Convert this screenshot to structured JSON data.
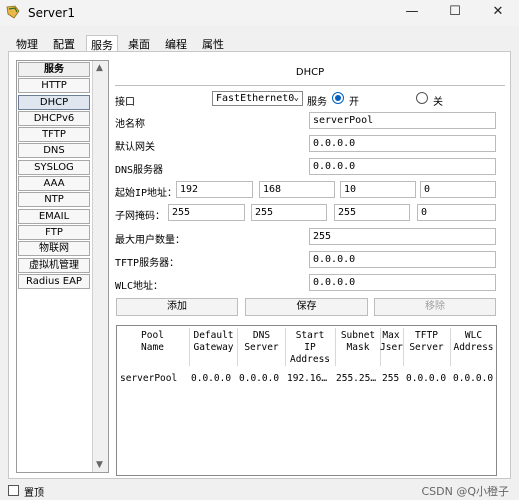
{
  "window": {
    "title": "Server1",
    "minimize": "—",
    "maximize": "☐",
    "close": "✕"
  },
  "tabs": [
    {
      "label": "物理"
    },
    {
      "label": "配置"
    },
    {
      "label": "服务"
    },
    {
      "label": "桌面"
    },
    {
      "label": "编程"
    },
    {
      "label": "属性"
    }
  ],
  "sidebar": {
    "items": [
      {
        "label": "服务"
      },
      {
        "label": "HTTP"
      },
      {
        "label": "DHCP"
      },
      {
        "label": "DHCPv6"
      },
      {
        "label": "TFTP"
      },
      {
        "label": "DNS"
      },
      {
        "label": "SYSLOG"
      },
      {
        "label": "AAA"
      },
      {
        "label": "NTP"
      },
      {
        "label": "EMAIL"
      },
      {
        "label": "FTP"
      },
      {
        "label": "物联网"
      },
      {
        "label": "虚拟机管理"
      },
      {
        "label": "Radius EAP"
      }
    ]
  },
  "dhcp": {
    "title": "DHCP",
    "interface_label": "接口",
    "interface_value": "FastEthernet0",
    "service_label": "服务",
    "on_label": "开",
    "off_label": "关",
    "pool_name_label": "池名称",
    "pool_name_value": "serverPool",
    "gateway_label": "默认网关",
    "gateway_value": "0.0.0.0",
    "dns_label": "DNS服务器",
    "dns_value": "0.0.0.0",
    "start_ip_label": "起始IP地址：",
    "start_ip": [
      "192",
      "168",
      "10",
      "0"
    ],
    "mask_label": "子网掩码：",
    "mask": [
      "255",
      "255",
      "255",
      "0"
    ],
    "max_users_label": "最大用户数量：",
    "max_users_value": "255",
    "tftp_label": "TFTP服务器：",
    "tftp_value": "0.0.0.0",
    "wlc_label": "WLC地址：",
    "wlc_value": "0.0.0.0",
    "add_button": "添加",
    "save_button": "保存",
    "remove_button": "移除"
  },
  "table": {
    "headers": [
      {
        "l1": "Pool",
        "l2": "Name",
        "l3": ""
      },
      {
        "l1": "Default",
        "l2": "Gateway",
        "l3": ""
      },
      {
        "l1": "DNS",
        "l2": "Server",
        "l3": ""
      },
      {
        "l1": "Start",
        "l2": "IP",
        "l3": "Address"
      },
      {
        "l1": "Subnet",
        "l2": "Mask",
        "l3": ""
      },
      {
        "l1": "Max",
        "l2": "Jser",
        "l3": ""
      },
      {
        "l1": "TFTP",
        "l2": "Server",
        "l3": ""
      },
      {
        "l1": "WLC",
        "l2": "Address",
        "l3": ""
      }
    ],
    "rows": [
      [
        "serverPool",
        "0.0.0.0",
        "0.0.0.0",
        "192.16…",
        "255.25…",
        "255",
        "0.0.0.0",
        "0.0.0.0"
      ]
    ]
  },
  "footer": {
    "top_label": "置顶",
    "watermark": "CSDN @Q小橙子"
  }
}
